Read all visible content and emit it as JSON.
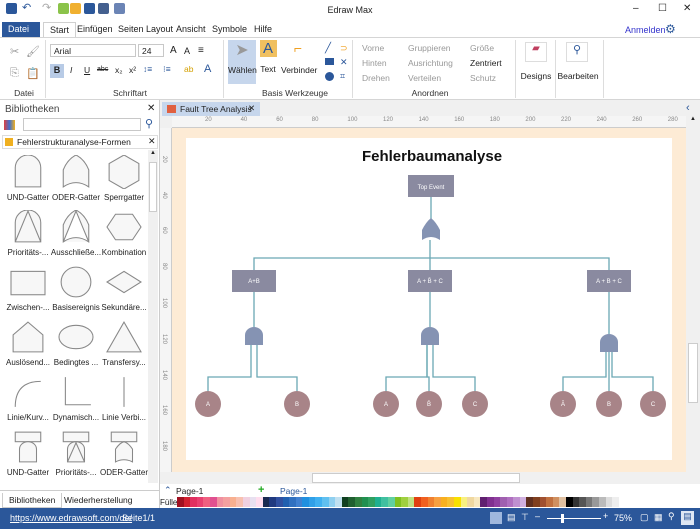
{
  "app": {
    "title": "Edraw Max",
    "signin": "Anmelden"
  },
  "menu": {
    "tabs": [
      "Datei",
      "Start",
      "Einfügen",
      "Seiten Layout",
      "Ansicht",
      "Symbole",
      "Hilfe"
    ]
  },
  "ribbon": {
    "groups": {
      "datei": "Datei",
      "schriftart": "Schriftart",
      "basis": "Basis Werkzeuge",
      "anordnen": "Anordnen"
    },
    "font": "Arial",
    "font_size": "24",
    "tools": {
      "select": "Wählen",
      "text": "Text",
      "connector": "Verbinder"
    },
    "arrange": [
      "Vorne",
      "Gruppieren",
      "Größe",
      "Hinten",
      "Ausrichtung",
      "Zentriert",
      "Drehen",
      "Verteilen",
      "Schutz"
    ],
    "designs": "Designs",
    "edit": "Bearbeiten"
  },
  "library": {
    "title": "Bibliotheken",
    "search_placeholder": "",
    "category": "Fehlerstrukturanalyse-Formen",
    "shapes": [
      "UND-Gatter",
      "ODER-Gatter",
      "Sperrgatter",
      "Prioritäts-...",
      "Ausschließe...",
      "Kombination",
      "Zwischen-...",
      "Basisereignis",
      "Sekundäre...",
      "Auslösend...",
      "Bedingtes ...",
      "Transfersy...",
      "Linie/Kurv...",
      "Dynamisch...",
      "Linie Verbi...",
      "UND-Gatter",
      "Prioritäts-...",
      "ODER-Gatter"
    ],
    "bottom_tabs": [
      "Bibliotheken",
      "Wiederherstellung"
    ]
  },
  "document": {
    "tab": "Fault Tree Analysis",
    "ruler_h": [
      "20",
      "40",
      "60",
      "80",
      "100",
      "120",
      "140",
      "160",
      "180",
      "200",
      "220",
      "240",
      "260",
      "280"
    ],
    "ruler_v": [
      "20",
      "40",
      "60",
      "80",
      "100",
      "120",
      "140",
      "160",
      "180"
    ]
  },
  "diagram": {
    "title": "Fehlerbaumanalyse",
    "top_event": "Top Event",
    "events": [
      "A+B",
      "A + B̄ + C",
      "A + B + C"
    ],
    "basic": [
      "A",
      "B",
      "A",
      "B̄",
      "C",
      "Ā",
      "B",
      "C"
    ],
    "colors": {
      "box": "#8a8aa0",
      "gate": "#8593b3",
      "basic": "#a88488",
      "line": "#6aa8b4",
      "page_border": "#fdebd5"
    }
  },
  "pages": {
    "selector": "Page-1",
    "tab": "Page-1",
    "fill_label": "Füller"
  },
  "status": {
    "url": "https://www.edrawsoft.com/de/",
    "page": "Seite1/1",
    "zoom": "75%",
    "zoom_value": 75
  },
  "accent": "#2b579a"
}
